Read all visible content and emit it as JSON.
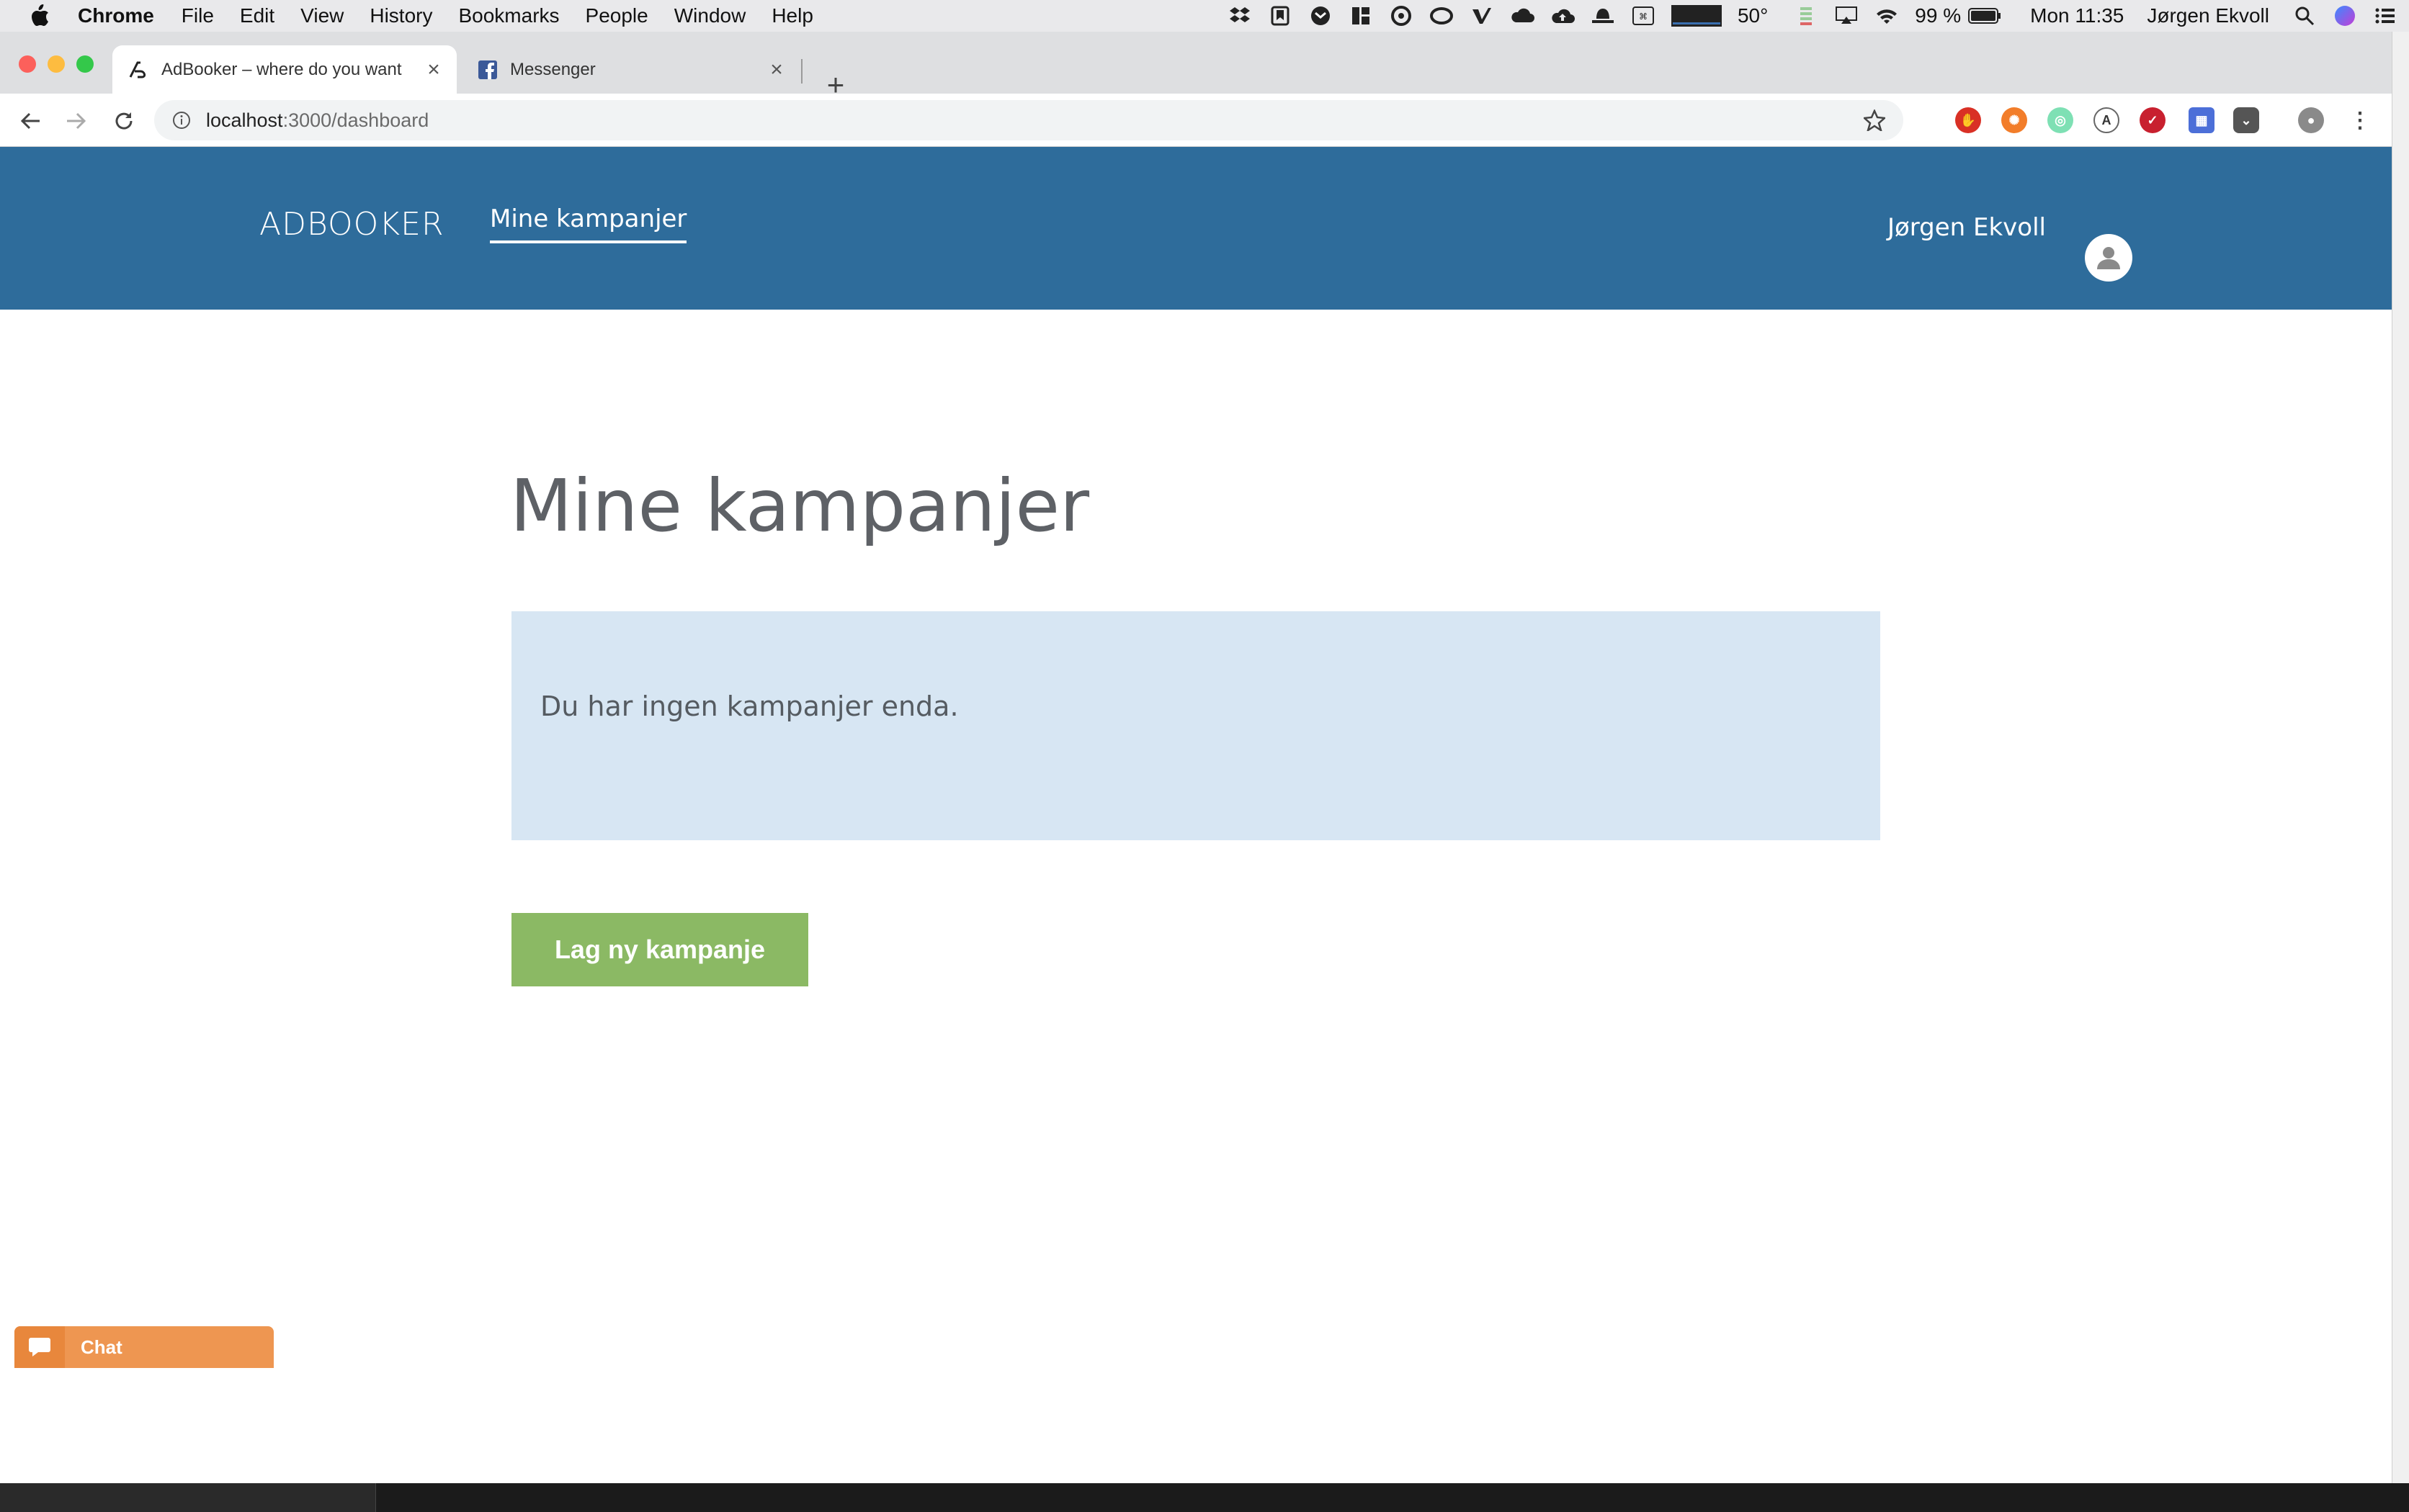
{
  "menubar": {
    "app_name": "Chrome",
    "items": [
      "File",
      "Edit",
      "View",
      "History",
      "Bookmarks",
      "People",
      "Window",
      "Help"
    ],
    "temperature": "50°",
    "battery": "99 %",
    "clock": "Mon 11:35",
    "user": "Jørgen Ekvoll"
  },
  "browser": {
    "tabs": [
      {
        "title": "AdBooker – where do you want",
        "active": true
      },
      {
        "title": "Messenger",
        "active": false
      }
    ],
    "url_host": "localhost",
    "url_path": ":3000/dashboard"
  },
  "site": {
    "brand": "ADBOOKER",
    "nav": [
      "Mine kampanjer"
    ],
    "user_name": "Jørgen Ekvoll"
  },
  "main": {
    "title": "Mine kampanjer",
    "empty_message": "Du har ingen kampanjer enda.",
    "create_button": "Lag ny kampanje"
  },
  "chat": {
    "label": "Chat"
  },
  "colors": {
    "header": "#2e6c9b",
    "notice_bg": "#d7e6f3",
    "primary_button": "#8bb964",
    "chat": "#ee9651"
  }
}
